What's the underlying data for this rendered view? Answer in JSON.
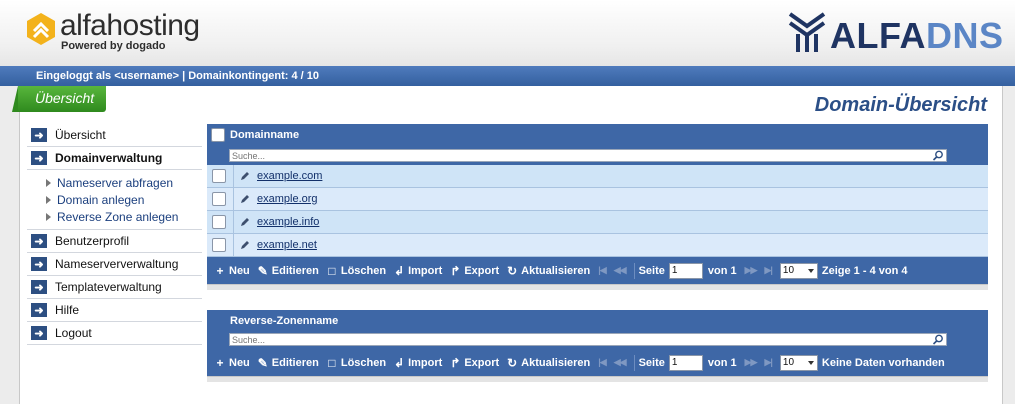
{
  "brand": {
    "name": "alfahosting",
    "tagline": "Powered by dogado",
    "product_a": "ALFA",
    "product_b": "DNS"
  },
  "statusbar": {
    "text": "Eingeloggt als <username> | Domainkontingent: 4 / 10"
  },
  "tab": {
    "label": "Übersicht"
  },
  "page_title": "Domain-Übersicht",
  "sidebar": {
    "items": [
      {
        "label": "Übersicht",
        "bold": false
      },
      {
        "label": "Domainverwaltung",
        "bold": true
      }
    ],
    "subitems": [
      {
        "label": "Nameserver abfragen"
      },
      {
        "label": "Domain anlegen"
      },
      {
        "label": "Reverse Zone anlegen"
      }
    ],
    "items_after": [
      {
        "label": "Benutzerprofil"
      },
      {
        "label": "Nameserververwaltung"
      },
      {
        "label": "Templateverwaltung"
      },
      {
        "label": "Hilfe"
      },
      {
        "label": "Logout"
      }
    ]
  },
  "domain_grid": {
    "header": "Domainname",
    "search_placeholder": "Suche...",
    "rows": [
      "example.com",
      "example.org",
      "example.info",
      "example.net"
    ],
    "toolbar": {
      "new": "Neu",
      "edit": "Editieren",
      "delete": "Löschen",
      "import": "Import",
      "export": "Export",
      "refresh": "Aktualisieren",
      "page_label": "Seite",
      "page_value": "1",
      "of": "von 1",
      "page_size": "10",
      "info": "Zeige 1 - 4 von 4"
    }
  },
  "reverse_grid": {
    "header": "Reverse-Zonenname",
    "search_placeholder": "Suche...",
    "toolbar": {
      "new": "Neu",
      "edit": "Editieren",
      "delete": "Löschen",
      "import": "Import",
      "export": "Export",
      "refresh": "Aktualisieren",
      "page_label": "Seite",
      "page_value": "1",
      "of": "von 1",
      "page_size": "10",
      "info": "Keine Daten vorhanden"
    }
  },
  "icons": {
    "nav_arrow": "arrow-right-icon",
    "sub_bullet": "triangle-right-icon",
    "search": "magnifier-icon",
    "edit": "pencil-icon"
  },
  "colors": {
    "accent_blue": "#3e67a6",
    "status_blue": "#34609f",
    "tab_green": "#3d9a28",
    "title_blue": "#2b4f87",
    "row_light": "#cfe4f7"
  }
}
